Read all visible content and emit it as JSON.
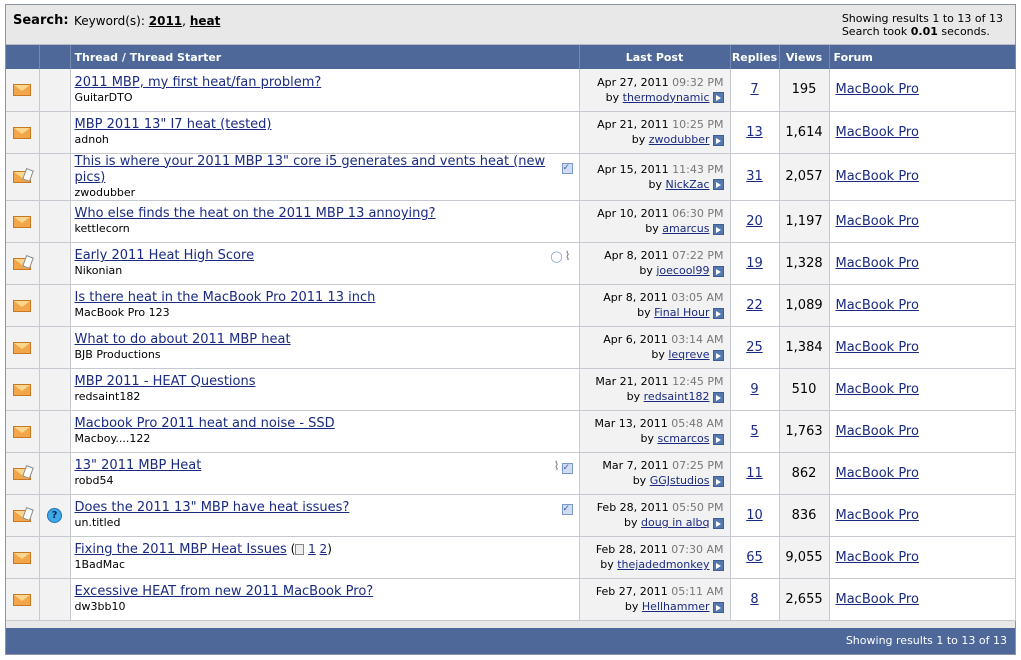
{
  "header": {
    "label": "Search:",
    "keywords_prefix": "Keyword(s):",
    "keyword1": "2011",
    "keyword_sep": ",",
    "keyword2": "heat",
    "showing": "Showing results 1 to 13 of 13",
    "took_prefix": "Search took",
    "took_value": "0.01",
    "took_suffix": "seconds."
  },
  "columns": {
    "thread": "Thread / Thread Starter",
    "last_post": "Last Post",
    "replies": "Replies",
    "views": "Views",
    "forum": "Forum"
  },
  "rows": [
    {
      "title": "2011 MBP, my first heat/fan problem?",
      "starter": "GuitarDTO",
      "date": "Apr 27, 2011",
      "time": "09:32 PM",
      "by": "thermodynamic",
      "replies": "7",
      "views": "195",
      "forum": "MacBook Pro",
      "hot": false
    },
    {
      "title": "MBP 2011 13\" I7 heat (tested)",
      "starter": "adnoh",
      "date": "Apr 21, 2011",
      "time": "10:25 PM",
      "by": "zwodubber",
      "replies": "13",
      "views": "1,614",
      "forum": "MacBook Pro",
      "hot": false
    },
    {
      "title": "This is where your 2011 MBP 13\" core i5 generates and vents heat (new pics)",
      "starter": "zwodubber",
      "date": "Apr 15, 2011",
      "time": "11:43 PM",
      "by": "NickZac",
      "replies": "31",
      "views": "2,057",
      "forum": "MacBook Pro",
      "hot": true
    },
    {
      "title": "Who else finds the heat on the 2011 MBP 13 annoying?",
      "starter": "kettlecorn",
      "date": "Apr 10, 2011",
      "time": "06:30 PM",
      "by": "amarcus",
      "replies": "20",
      "views": "1,197",
      "forum": "MacBook Pro",
      "hot": false
    },
    {
      "title": "Early 2011 Heat High Score",
      "starter": "Nikonian",
      "date": "Apr 8, 2011",
      "time": "07:22 PM",
      "by": "joecool99",
      "replies": "19",
      "views": "1,328",
      "forum": "MacBook Pro",
      "hot": true
    },
    {
      "title": "Is there heat in the MacBook Pro 2011 13 inch",
      "starter": "MacBook Pro 123",
      "date": "Apr 8, 2011",
      "time": "03:05 AM",
      "by": "Final Hour",
      "replies": "22",
      "views": "1,089",
      "forum": "MacBook Pro",
      "hot": false
    },
    {
      "title": "What to do about 2011 MBP heat",
      "starter": "BJB Productions",
      "date": "Apr 6, 2011",
      "time": "03:14 AM",
      "by": "leqreve",
      "replies": "25",
      "views": "1,384",
      "forum": "MacBook Pro",
      "hot": false
    },
    {
      "title": "MBP 2011 - HEAT Questions",
      "starter": "redsaint182",
      "date": "Mar 21, 2011",
      "time": "12:45 PM",
      "by": "redsaint182",
      "replies": "9",
      "views": "510",
      "forum": "MacBook Pro",
      "hot": false
    },
    {
      "title": "Macbook Pro 2011 heat and noise - SSD",
      "starter": "Macboy....122",
      "date": "Mar 13, 2011",
      "time": "05:48 AM",
      "by": "scmarcos",
      "replies": "5",
      "views": "1,763",
      "forum": "MacBook Pro",
      "hot": false
    },
    {
      "title": "13\" 2011 MBP Heat",
      "starter": "robd54",
      "date": "Mar 7, 2011",
      "time": "07:25 PM",
      "by": "GGJstudios",
      "replies": "11",
      "views": "862",
      "forum": "MacBook Pro",
      "hot": true
    },
    {
      "title": "Does the 2011 13\" MBP have heat issues?",
      "starter": "un.titled",
      "date": "Feb 28, 2011",
      "time": "05:50 PM",
      "by": "doug in albq",
      "replies": "10",
      "views": "836",
      "forum": "MacBook Pro",
      "hot": true
    },
    {
      "title": "Fixing the 2011 MBP Heat Issues",
      "starter": "1BadMac",
      "date": "Feb 28, 2011",
      "time": "07:30 AM",
      "by": "thejadedmonkey",
      "replies": "65",
      "views": "9,055",
      "forum": "MacBook Pro",
      "hot": false
    },
    {
      "title": "Excessive HEAT from new 2011 MacBook Pro?",
      "starter": "dw3bb10",
      "date": "Feb 27, 2011",
      "time": "05:11 AM",
      "by": "Hellhammer",
      "replies": "8",
      "views": "2,655",
      "forum": "MacBook Pro",
      "hot": false
    }
  ],
  "misc": {
    "by_prefix": "by",
    "question_mark": "?",
    "page1": "1",
    "page2": "2",
    "paren_open": "(",
    "paren_close": ")",
    "checkmark": "✓",
    "clip": "⌇"
  },
  "footer": {
    "showing": "Showing results 1 to 13 of 13"
  },
  "colors": {
    "header_bg": "#4d6899",
    "link": "#1a2a82",
    "alt_cell": "#f2f2f2"
  }
}
